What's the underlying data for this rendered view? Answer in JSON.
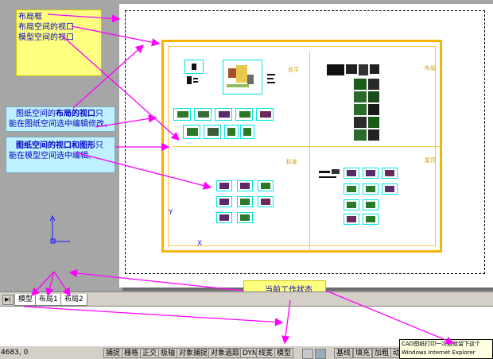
{
  "notes": {
    "layout_frame": "布局框",
    "paper_space_viewport": "布局空间的视口",
    "model_space_viewport": "模型空间的视口",
    "paper_viewport_line1_a": "图纸空间的",
    "paper_viewport_line1_b": "布局的视口",
    "paper_viewport_line1_c": "只",
    "paper_viewport_line2": "能在图纸空间选中编辑修改。",
    "viewport_graphics_line1_a": "图纸空间的视口和图形",
    "viewport_graphics_line1_b": "只",
    "viewport_graphics_line2": "能在模型空间选中编辑。",
    "current_state": "当前工作状态"
  },
  "viewport_tags": {
    "top_left": "总平",
    "top_right": "布局",
    "bottom_left": "标准",
    "bottom_right": "屋顶"
  },
  "ucs": {
    "y": "Y",
    "x": "X"
  },
  "tabs": {
    "nav": "▶|",
    "model": "模型",
    "layout1": "布局1",
    "layout2": "布局2"
  },
  "status": {
    "coords": "4683, 0",
    "snap": "捕捉",
    "grid": "栅格",
    "ortho": "正交",
    "polar": "极轴",
    "osnap": "对象捕捉",
    "otrack": "对象追踪",
    "dyn": "DYN",
    "lwt": "线宽",
    "model": "模型",
    "baseline": "基线",
    "fill": "填充",
    "bold": "加粗",
    "anim": "动"
  },
  "popup": {
    "line1": "CAD图纸打印一次后就留下这个",
    "line2": "Windows Internet Explorer"
  },
  "colors": {
    "arrow": "#ff00ff",
    "viewport": "#f5b400",
    "note_yellow": "#ffff80",
    "note_cyan": "#bff0ff"
  }
}
